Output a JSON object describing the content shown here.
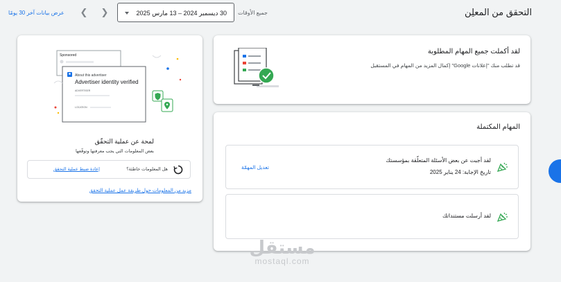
{
  "header": {
    "title": "التحقق من المعلِن",
    "range_label": "جميع الأوقات",
    "date_range": "30 ديسمبر 2024 – 13 مارس 2025",
    "last_30_days": "عرض بيانات آخر 30 يومًا"
  },
  "summary_card": {
    "title": "لقد أكملت جميع المهام المطلوبة",
    "body": "قد تطلب منك \"إعلانات Google\" إكمال المزيد من المهام في المستقبل"
  },
  "tasks_card": {
    "title": "المهام المكتملة",
    "tasks": [
      {
        "title": "لقد أجبت عن بعض الأسئلة المتعلّقة بمؤسستك",
        "subtitle": "تاريخ الإجابة: 24 يناير 2025",
        "action": "تعديل المهمّة"
      },
      {
        "title": "لقد أرسلت مستنداتك"
      }
    ]
  },
  "overview_card": {
    "illustration": {
      "sponsored": "Sponsored",
      "about_label": "About this advertiser",
      "verified_title": "Advertiser identity verified",
      "advertiser_label": "ADVERTISER",
      "location_label": "LOCATION"
    },
    "title": "لمحة عن عملية التحقّق",
    "body": "بعض المعلومات التي يجب معرفتها وتوقّعها",
    "info_question": "هل المعلومات خاطئة؟",
    "reset_link": "إعادة ضبط عملية التحقق",
    "learn_more": "مزيد من المعلومات حول طريقة عمل عملية التحقق"
  },
  "watermark": {
    "arabic": "مستقل",
    "latin": "mostaql.com"
  },
  "colors": {
    "accent": "#1a73e8",
    "success": "#34a853",
    "background": "#f1f3f4"
  },
  "icons": [
    "chevron-left-icon",
    "chevron-right-icon",
    "dropdown-caret-icon",
    "checklist-illustration",
    "party-popper-icon",
    "history-icon",
    "shield-check-icon",
    "location-pin-icon"
  ]
}
